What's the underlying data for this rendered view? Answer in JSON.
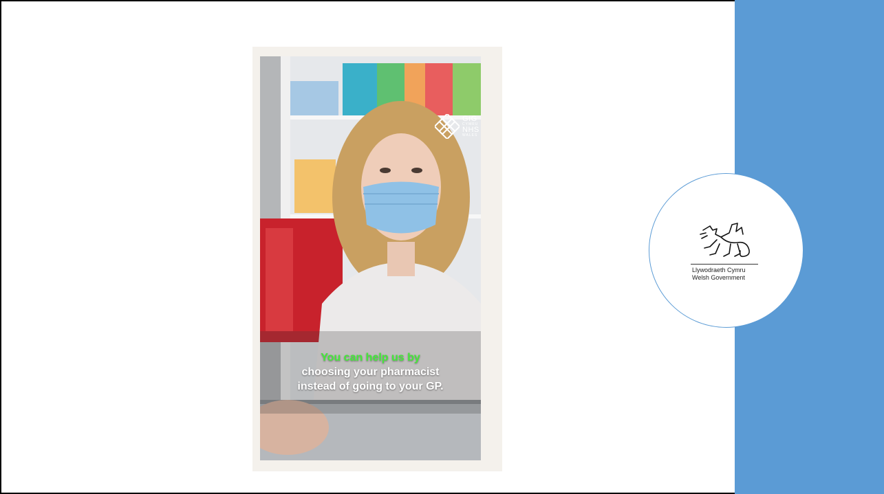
{
  "slide": {
    "caption": {
      "highlight": "You can help us by",
      "line2": "choosing your pharmacist",
      "line3": "instead of going to your GP."
    },
    "nhs_logo": {
      "line1": "GIG",
      "line2": "CYMRU",
      "line3": "NHS",
      "line4": "WALES"
    },
    "welsh_gov_logo": {
      "line1": "Llywodraeth Cymru",
      "line2": "Welsh Government"
    }
  },
  "colors": {
    "panel": "#5b9bd5",
    "caption_highlight": "#45e83a"
  }
}
